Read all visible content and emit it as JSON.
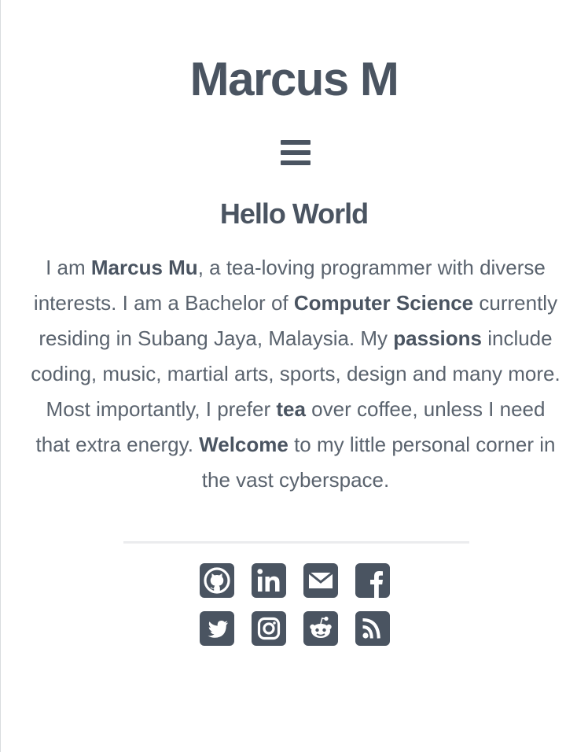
{
  "header": {
    "title": "Marcus M",
    "menu_icon": "hamburger-menu-icon"
  },
  "main": {
    "heading": "Hello World",
    "intro": {
      "p1": "I am ",
      "name": "Marcus Mu",
      "p2": ", a tea-loving programmer with diverse interests. I am a Bachelor of ",
      "degree": "Computer Science",
      "p3": " currently residing in Subang Jaya, Malaysia. My ",
      "passions": "passions",
      "p4": " include coding, music, martial arts, sports, design and many more. Most importantly, I prefer ",
      "tea": "tea",
      "p5": " over coffee, unless I need that extra energy. ",
      "welcome": "Welcome",
      "p6": " to my little personal corner in the vast cyberspace."
    }
  },
  "social": {
    "row1": [
      "github-icon",
      "linkedin-icon",
      "email-icon",
      "facebook-icon"
    ],
    "row2": [
      "twitter-icon",
      "instagram-icon",
      "reddit-icon",
      "rss-icon"
    ]
  },
  "colors": {
    "text": "#4a5461",
    "body_text": "#5a636e",
    "divider": "#ebecee",
    "background": "#ffffff"
  }
}
